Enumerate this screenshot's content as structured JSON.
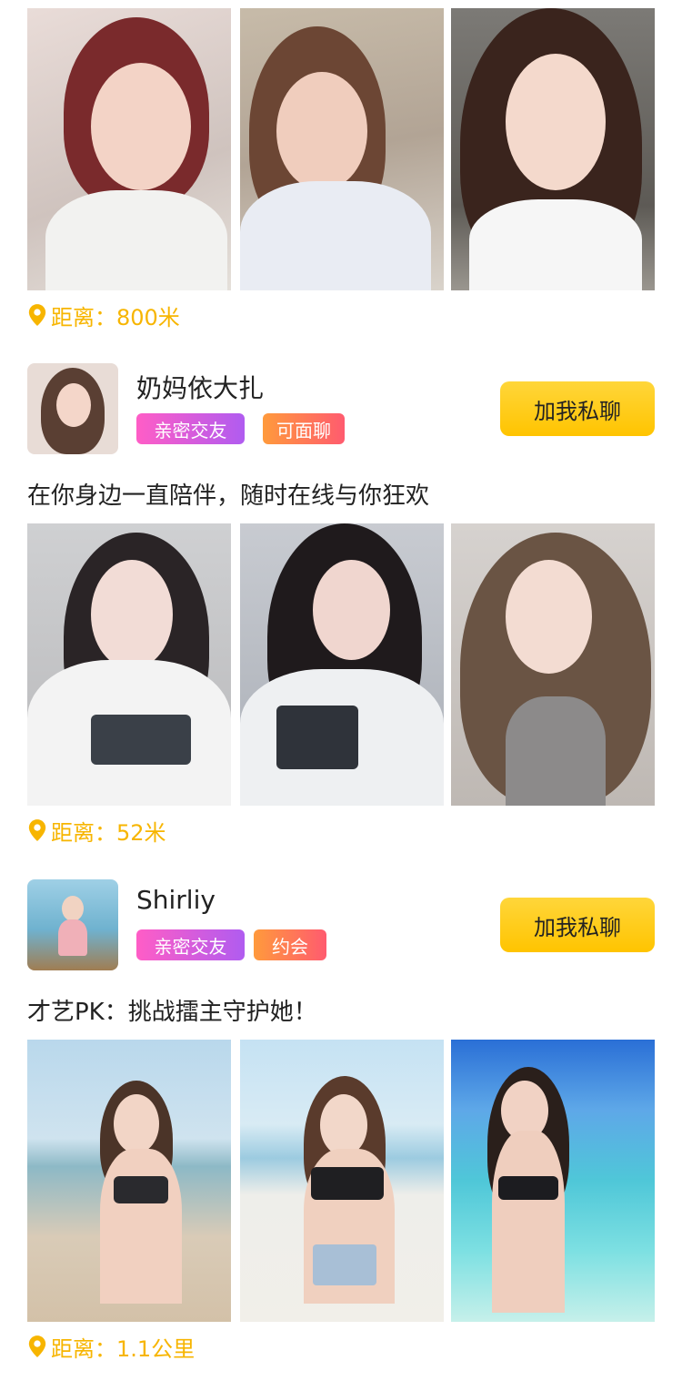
{
  "posts": [
    {
      "distance_label": "距离：800米",
      "photos": [
        {
          "icon": "woman-selfie-photo"
        },
        {
          "icon": "woman-selfie-photo"
        },
        {
          "icon": "woman-selfie-photo"
        }
      ]
    },
    {
      "name": "奶妈依大扎",
      "tags": [
        "亲密交友",
        "可面聊"
      ],
      "chat_button": "加我私聊",
      "bio": "在你身边一直陪伴，随时在线与你狂欢",
      "distance_label": "距离：52米"
    },
    {
      "name": "Shirliy",
      "tags": [
        "亲密交友",
        "约会"
      ],
      "chat_button": "加我私聊",
      "bio": "才艺PK：挑战擂主守护她！",
      "distance_label": "距离：1.1公里"
    }
  ],
  "colors": {
    "accent_yellow": "#f7b500",
    "button_yellow": "#ffc400",
    "tag_pink": "#e75fd8",
    "tag_orange": "#ff7a52"
  }
}
